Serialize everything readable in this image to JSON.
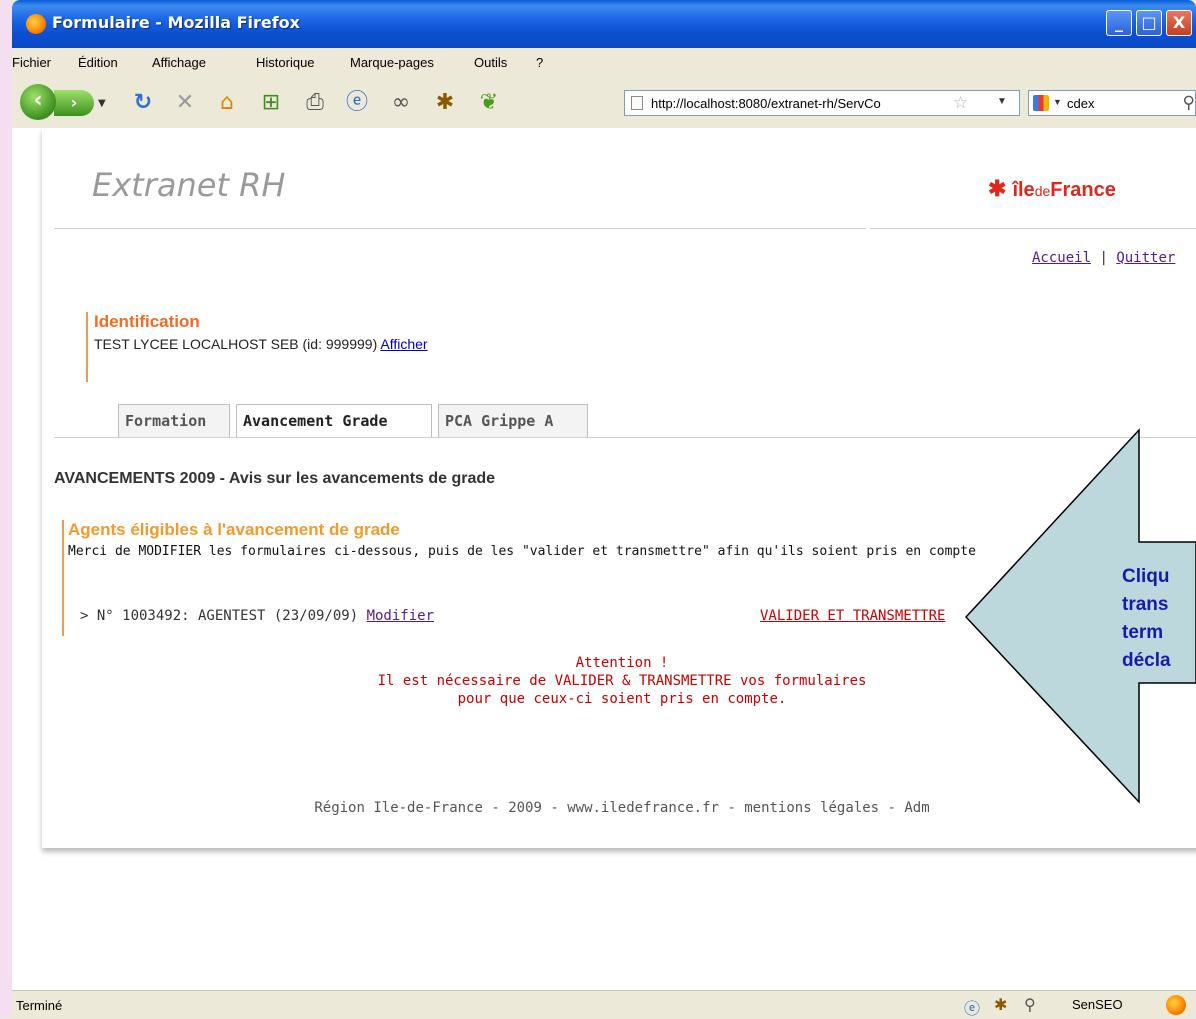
{
  "window": {
    "title": "Formulaire - Mozilla Firefox",
    "min_label": "_",
    "max_label": "□",
    "close_label": "X"
  },
  "menu": [
    "Fichier",
    "Édition",
    "Affichage",
    "Historique",
    "Marque-pages",
    "Outils",
    "?"
  ],
  "toolbar": {
    "url": "http://localhost:8080/extranet-rh/ServCo",
    "search_text": "cdex"
  },
  "page": {
    "brand": "Extranet RH",
    "logo": {
      "ile": "île",
      "de": "de",
      "france": "France"
    },
    "links": {
      "accueil": "Accueil",
      "sep": "|",
      "quitter": "Quitter"
    },
    "identification": {
      "title": "Identification",
      "text": "TEST LYCEE LOCALHOST SEB (id: 999999) ",
      "link": "Afficher"
    },
    "tabs": [
      "Formation",
      "Avancement Grade",
      "PCA Grippe A"
    ],
    "active_tab": "Avancement Grade",
    "section_title": "AVANCEMENTS 2009 - Avis sur les avancements de grade",
    "agents": {
      "title": "Agents éligibles à l'avancement de grade",
      "text": "Merci de MODIFIER les formulaires ci-dessous, puis de les \"valider et transmettre\" afin qu'ils soient pris en compte",
      "row_text": "> N° 1003492: AGENTEST (23/09/09) ",
      "row_link": "Modifier",
      "valider": "VALIDER ET TRANSMETTRE"
    },
    "attention": [
      "Attention !",
      "Il est nécessaire de VALIDER & TRANSMETTRE vos formulaires",
      "pour que ceux-ci soient pris en compte."
    ],
    "footer": "Région Ile-de-France - 2009 - www.iledefrance.fr - mentions légales - Adm"
  },
  "callout": {
    "lines": [
      "Cliqu",
      "trans",
      "term",
      "décla"
    ],
    "fill": "#bcd8dc"
  },
  "status": {
    "text": "Terminé",
    "seo": "SenSEO"
  }
}
